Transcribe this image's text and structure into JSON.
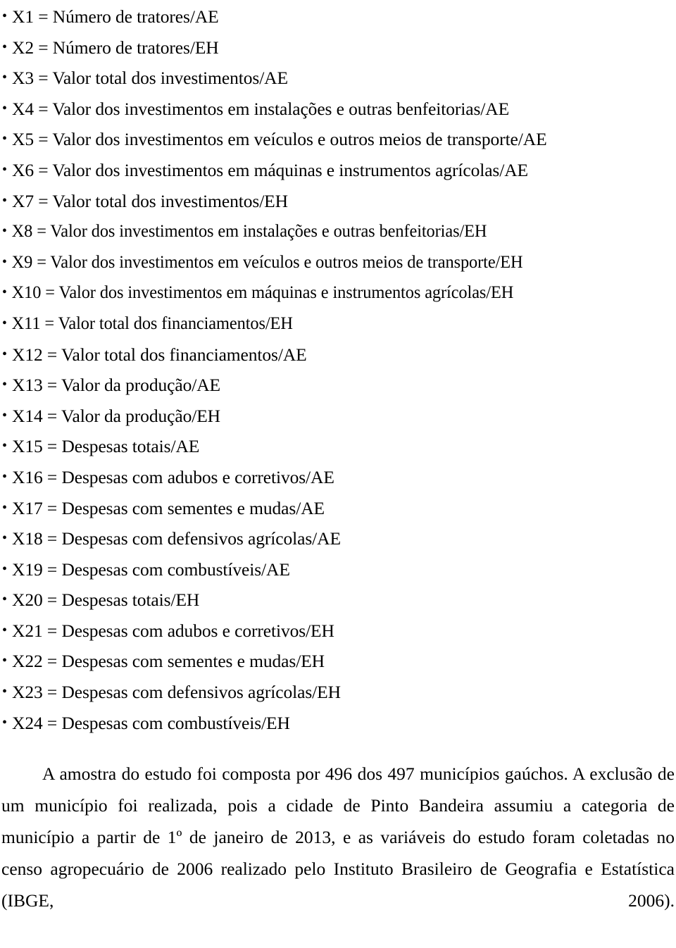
{
  "document": {
    "variables_list": [
      {
        "id": "X1",
        "label": "X1 = Número de tratores/AE"
      },
      {
        "id": "X2",
        "label": "X2 = Número de tratores/EH"
      },
      {
        "id": "X3",
        "label": "X3 = Valor total dos investimentos/AE"
      },
      {
        "id": "X4",
        "label": "X4 = Valor dos investimentos em instalações e outras benfeitorias/AE"
      },
      {
        "id": "X5",
        "label": "X5 = Valor dos investimentos em veículos e outros meios de transporte/AE"
      },
      {
        "id": "X6",
        "label": "X6 = Valor dos investimentos em máquinas e instrumentos agrícolas/AE"
      },
      {
        "id": "X7",
        "label": "X7 = Valor total dos investimentos/EH"
      },
      {
        "id": "X8",
        "label": "X8 = Valor dos investimentos em instalações e outras benfeitorias/EH"
      },
      {
        "id": "X9",
        "label": "X9 = Valor dos investimentos em veículos e outros meios de transporte/EH"
      },
      {
        "id": "X10",
        "label": "X10 = Valor dos investimentos em máquinas e instrumentos agrícolas/EH"
      },
      {
        "id": "X11",
        "label": "X11 = Valor total dos financiamentos/EH"
      },
      {
        "id": "X12",
        "label": "X12 = Valor total dos financiamentos/AE"
      },
      {
        "id": "X13",
        "label": "X13 = Valor da produção/AE"
      },
      {
        "id": "X14",
        "label": "X14 = Valor da produção/EH"
      },
      {
        "id": "X15",
        "label": "X15 = Despesas totais/AE"
      },
      {
        "id": "X16",
        "label": "X16 = Despesas com adubos e corretivos/AE"
      },
      {
        "id": "X17",
        "label": "X17 = Despesas com sementes e mudas/AE"
      },
      {
        "id": "X18",
        "label": "X18 = Despesas com defensivos agrícolas/AE"
      },
      {
        "id": "X19",
        "label": "X19 = Despesas com combustíveis/AE"
      },
      {
        "id": "X20",
        "label": "X20 = Despesas totais/EH"
      },
      {
        "id": "X21",
        "label": "X21 = Despesas com adubos e corretivos/EH"
      },
      {
        "id": "X22",
        "label": "X22 = Despesas com sementes e mudas/EH"
      },
      {
        "id": "X23",
        "label": "X23 = Despesas com defensivos agrícolas/EH"
      },
      {
        "id": "X24",
        "label": "X24 = Despesas com combustíveis/EH"
      }
    ],
    "closing_paragraph": "A amostra do estudo foi composta por 496 dos 497 municípios gaúchos. A exclusão de um município foi realizada, pois a cidade de Pinto Bandeira assumiu a categoria de município a partir de 1º de janeiro de 2013, e as variáveis do estudo foram coletadas no censo agropecuário de 2006 realizado pelo Instituto Brasileiro de Geografia e Estatística (IBGE, 2006)."
  }
}
